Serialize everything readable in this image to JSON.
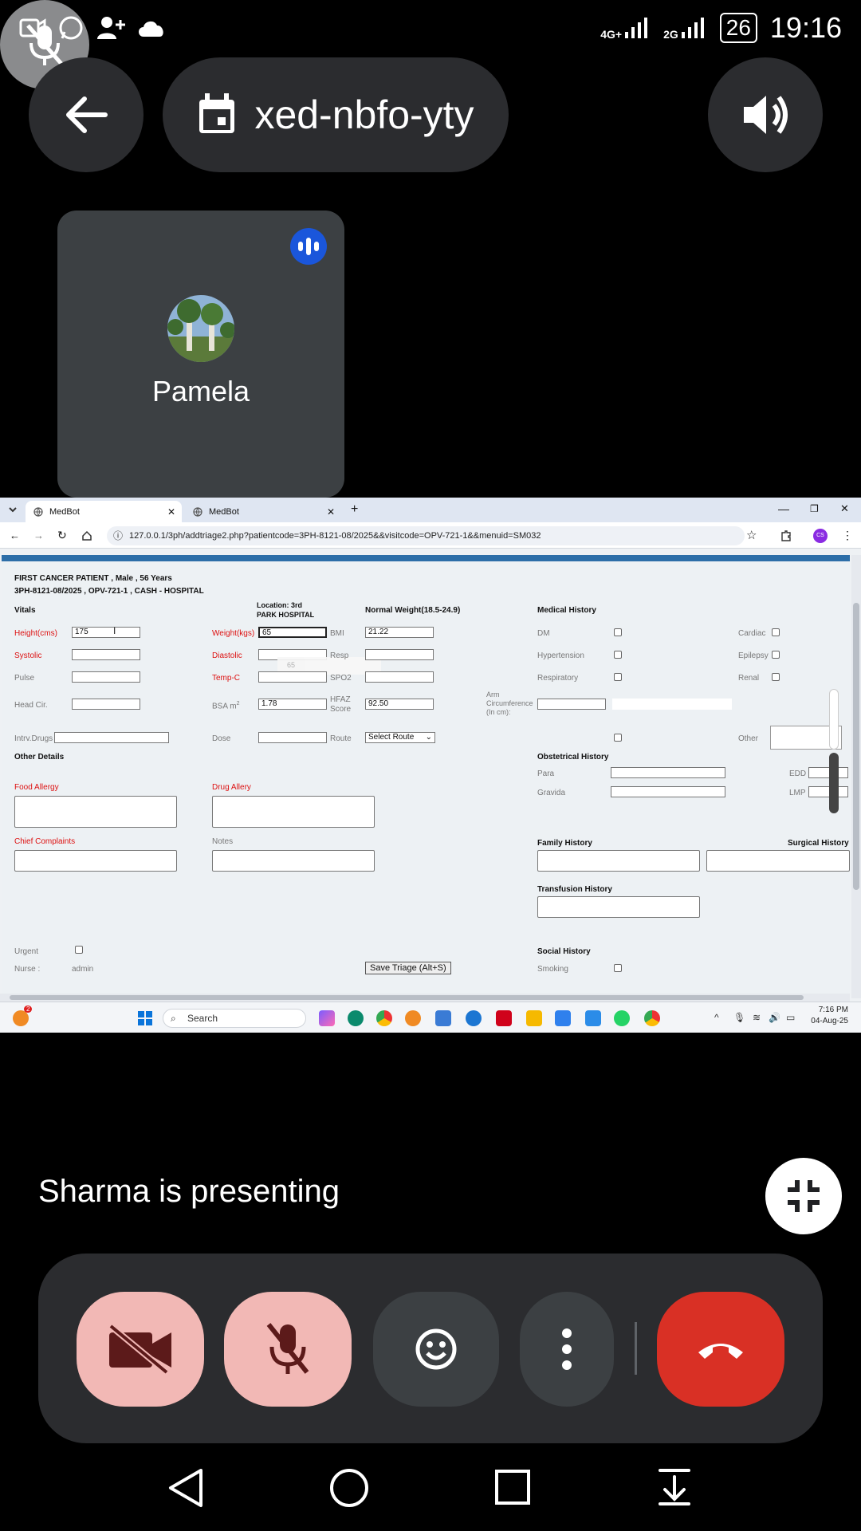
{
  "status_bar": {
    "time": "19:16",
    "battery": "26",
    "net1": "4G+",
    "net2": "2G"
  },
  "meeting": {
    "code": "xed-nbfo-yty",
    "participant_name": "Pamela",
    "presenting_text": "Sharma is presenting"
  },
  "browser": {
    "tabs": [
      {
        "label": "MedBot",
        "active": true
      },
      {
        "label": "MedBot",
        "active": false
      }
    ],
    "url": "127.0.0.1/3ph/addtriage2.php?patientcode=3PH-8121-08/2025&&visitcode=OPV-721-1&&menuid=SM032",
    "profile_initials": "CS"
  },
  "form": {
    "patient_line1": "FIRST CANCER PATIENT , Male , 56 Years",
    "patient_line2": "3PH-8121-08/2025 , OPV-721-1 , CASH - HOSPITAL",
    "location_label": "Location:  3rd",
    "location_value": "PARK HOSPITAL",
    "weight_status": "Normal Weight(18.5-24.9)",
    "vitals_title": "Vitals",
    "medical_history_title": "Medical History",
    "labels": {
      "height": "Height(cms)",
      "weight": "Weight(kgs)",
      "bmi": "BMI",
      "systolic": "Systolic",
      "diastolic": "Diastolic",
      "resp": "Resp",
      "pulse": "Pulse",
      "temp": "Temp-C",
      "spo2": "SPO2",
      "head": "Head Cir.",
      "bsa": "BSA m",
      "bsa_sup": "2",
      "hfaz1": "HFAZ",
      "hfaz2": "Score",
      "arm1": "Arm",
      "arm2": "Circumference",
      "arm3": "(In cm):",
      "intrv": "Intrv.Drugs",
      "dose": "Dose",
      "route": "Route",
      "other_details": "Other Details",
      "food_allergy": "Food Allergy",
      "drug_allergy": "Drug Allery",
      "chief": "Chief Complaints",
      "notes": "Notes",
      "urgent": "Urgent",
      "nurse": "Nurse :",
      "dm": "DM",
      "cardiac": "Cardiac",
      "hypertension": "Hypertension",
      "epilepsy": "Epilepsy",
      "respiratory": "Respiratory",
      "renal": "Renal",
      "other": "Other",
      "obstetrical": "Obstetrical History",
      "para": "Para",
      "gravida": "Gravida",
      "edd": "EDD",
      "lmp": "LMP",
      "family": "Family History",
      "surgical": "Surgical History",
      "transfusion": "Transfusion History",
      "social": "Social History",
      "smoking": "Smoking"
    },
    "values": {
      "height": "175",
      "weight": "65",
      "weight_tooltip": "65",
      "bmi": "21.22",
      "bsa": "1.78",
      "hfaz": "92.50",
      "nurse": "admin",
      "route_select": "Select Route"
    },
    "save_button": "Save Triage (Alt+S)"
  },
  "taskbar": {
    "search_placeholder": "Search",
    "time": "7:16 PM",
    "date": "04-Aug-25",
    "notification_count": "2"
  }
}
